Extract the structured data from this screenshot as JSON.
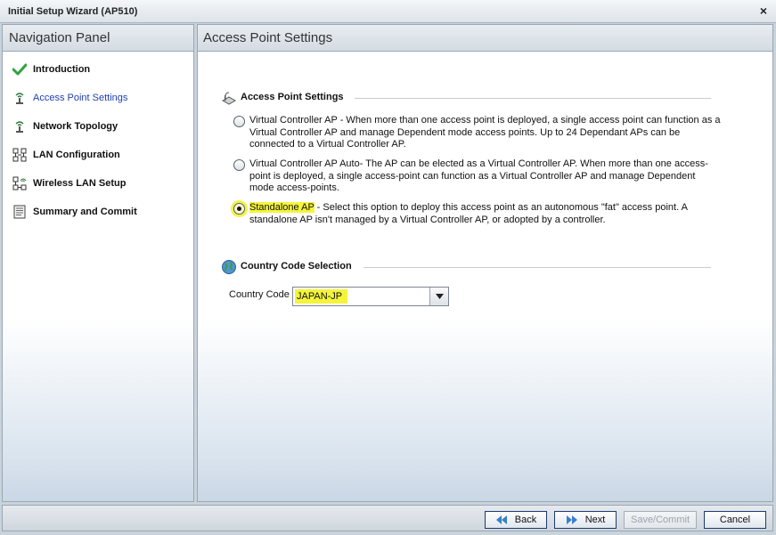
{
  "window": {
    "title": "Initial Setup Wizard (AP510)",
    "close_glyph": "×"
  },
  "nav": {
    "header": "Navigation Panel",
    "items": [
      {
        "label": "Introduction",
        "icon": "checkmark-icon"
      },
      {
        "label": "Access Point Settings",
        "icon": "access-point-icon",
        "active": true
      },
      {
        "label": "Network Topology",
        "icon": "access-point-icon"
      },
      {
        "label": "LAN Configuration",
        "icon": "network-icon"
      },
      {
        "label": "Wireless LAN Setup",
        "icon": "wireless-network-icon"
      },
      {
        "label": "Summary and Commit",
        "icon": "document-icon"
      }
    ]
  },
  "content": {
    "header": "Access Point Settings",
    "ap_section": {
      "title": "Access Point Settings",
      "options": [
        {
          "label": "Virtual Controller AP",
          "description": " - When more than one access point is deployed, a single access point can function as a Virtual Controller AP and manage Dependent mode access points. Up to 24 Dependant APs can be connected to a Virtual Controller AP.",
          "selected": false
        },
        {
          "label": "Virtual Controller AP Auto",
          "description": "- The AP can be elected as a Virtual Controller AP.  When more than one access-point is deployed, a single access-point can function as a Virtual Controller AP and manage Dependent mode access-points.",
          "selected": false
        },
        {
          "label": "Standalone AP",
          "description": " - Select this option to deploy this access point as an autonomous \"fat\" access point. A standalone AP isn't managed by a Virtual Controller AP, or adopted by a controller.",
          "selected": true
        }
      ]
    },
    "country_section": {
      "title": "Country Code Selection",
      "label": "Country Code",
      "value": "JAPAN-JP"
    }
  },
  "footer": {
    "back": "Back",
    "next": "Next",
    "save": "Save/Commit",
    "cancel": "Cancel"
  },
  "colors": {
    "highlight": "#f4f43c",
    "active_nav": "#1f3fae",
    "button_border": "#1e3a6e"
  }
}
